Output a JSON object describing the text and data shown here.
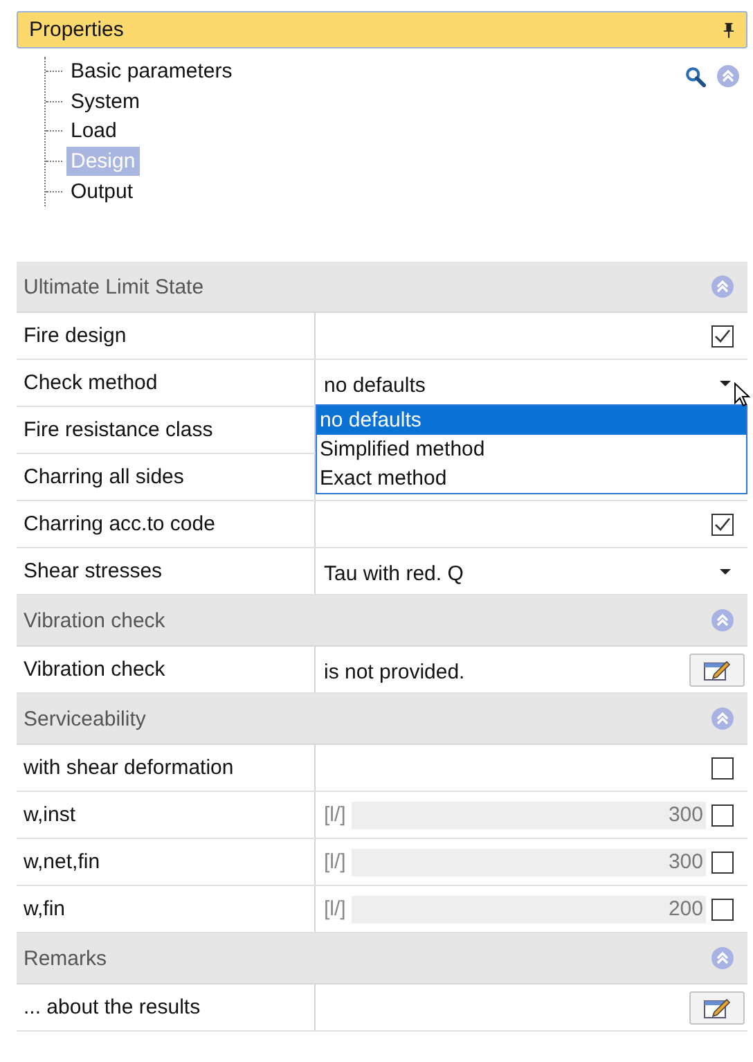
{
  "panel": {
    "title": "Properties"
  },
  "tree": [
    {
      "label": "Basic parameters",
      "selected": false
    },
    {
      "label": "System",
      "selected": false
    },
    {
      "label": "Load",
      "selected": false
    },
    {
      "label": "Design",
      "selected": true
    },
    {
      "label": "Output",
      "selected": false
    }
  ],
  "sections": [
    {
      "title": "Ultimate Limit State",
      "expanded": true,
      "rows": [
        {
          "kind": "check",
          "label": "Fire design",
          "checked": true
        },
        {
          "kind": "dropdown",
          "label": "Check method",
          "value": "no defaults",
          "open": true,
          "options": [
            {
              "label": "no defaults",
              "selected": true
            },
            {
              "label": "Simplified method",
              "selected": false
            },
            {
              "label": "Exact method",
              "selected": false
            }
          ]
        },
        {
          "kind": "plain",
          "label": "Fire resistance class"
        },
        {
          "kind": "plain",
          "label": "Charring all sides"
        },
        {
          "kind": "check",
          "label": "Charring acc.to code",
          "checked": true
        },
        {
          "kind": "dropdown",
          "label": "Shear stresses",
          "value": "Tau with red. Q",
          "open": false
        }
      ]
    },
    {
      "title": "Vibration check",
      "expanded": true,
      "rows": [
        {
          "kind": "edit",
          "label": "Vibration check",
          "value": "is not provided."
        }
      ]
    },
    {
      "title": "Serviceability",
      "expanded": true,
      "rows": [
        {
          "kind": "check",
          "label": "with shear deformation",
          "checked": false
        },
        {
          "kind": "limit",
          "label": "w,inst",
          "unit": "[l/]",
          "value": "300",
          "disabled": true,
          "checked": false
        },
        {
          "kind": "limit",
          "label": "w,net,fin",
          "unit": "[l/]",
          "value": "300",
          "disabled": true,
          "checked": false
        },
        {
          "kind": "limit",
          "label": "w,fin",
          "unit": "[l/]",
          "value": "200",
          "disabled": true,
          "checked": false
        }
      ]
    },
    {
      "title": "Remarks",
      "expanded": true,
      "rows": [
        {
          "kind": "edit",
          "label": "... about the results"
        }
      ]
    }
  ]
}
